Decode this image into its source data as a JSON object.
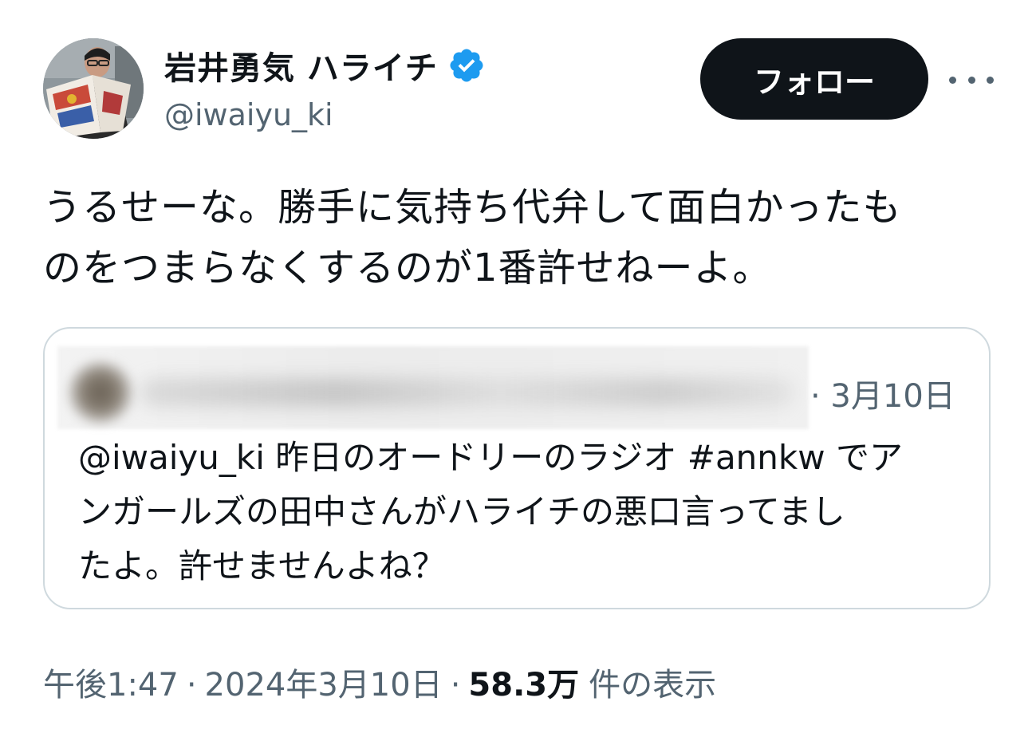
{
  "author": {
    "display_name": "岩井勇気 ハライチ",
    "handle": "@iwaiyu_ki",
    "verified": true
  },
  "actions": {
    "follow_label": "フォロー"
  },
  "tweet": {
    "text_lines": [
      "うるせーな。勝手に気持ち代弁して面白かったも",
      "のをつまらなくするのが1番許せねーよ。"
    ]
  },
  "quoted_tweet": {
    "date": "· 3月10日",
    "text_lines": [
      "@iwaiyu_ki 昨日のオードリーのラジオ #annkw でア",
      "ンガールズの田中さんがハライチの悪口言ってまし",
      "たよ。許せませんよね？"
    ]
  },
  "meta": {
    "time": "午後1:47",
    "separator": "·",
    "date": "2024年3月10日",
    "views_count": "58.3万",
    "views_label": "件の表示"
  },
  "colors": {
    "text_primary": "#0f1419",
    "text_secondary": "#536471",
    "verified_blue": "#1d9bf0",
    "follow_bg": "#0f1419",
    "card_border": "#cfd9de"
  },
  "icons": {
    "verified": "verified-badge-icon",
    "more": "more-dots-icon"
  }
}
